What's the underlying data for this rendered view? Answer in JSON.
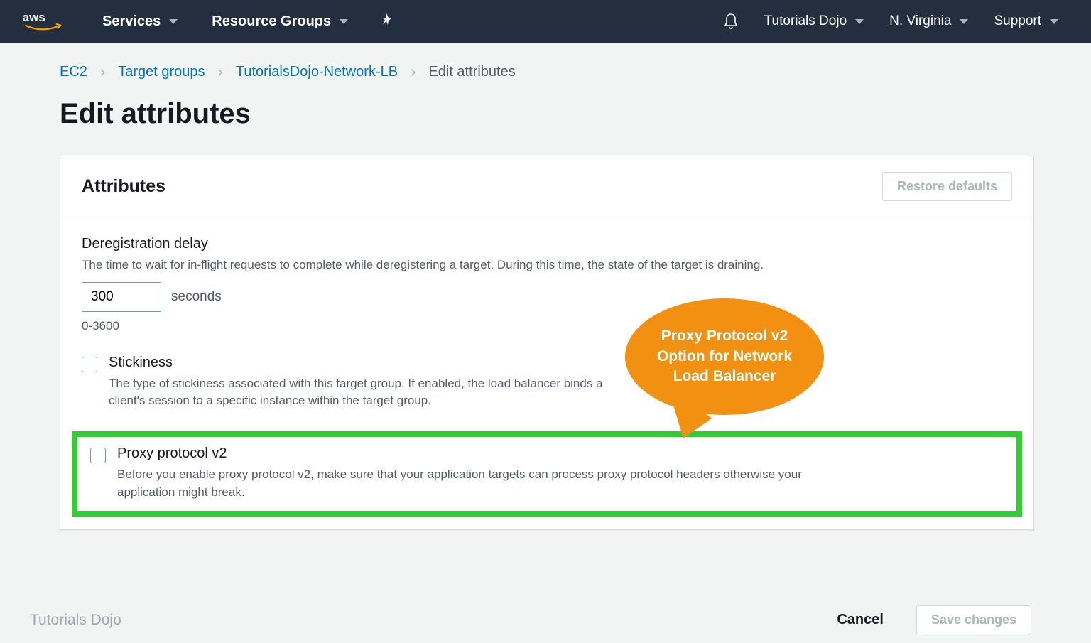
{
  "nav": {
    "services": "Services",
    "resource_groups": "Resource Groups",
    "account": "Tutorials Dojo",
    "region": "N. Virginia",
    "support": "Support"
  },
  "breadcrumb": {
    "items": [
      "EC2",
      "Target groups",
      "TutorialsDojo-Network-LB"
    ],
    "current": "Edit attributes"
  },
  "page": {
    "title": "Edit attributes"
  },
  "panel": {
    "title": "Attributes",
    "restore_btn": "Restore defaults"
  },
  "dereg": {
    "label": "Deregistration delay",
    "desc": "The time to wait for in-flight requests to complete while deregistering a target. During this time, the state of the target is draining.",
    "value": "300",
    "unit": "seconds",
    "range": "0-3600"
  },
  "stickiness": {
    "label": "Stickiness",
    "desc": "The type of stickiness associated with this target group. If enabled, the load balancer binds a client's session to a specific instance within the target group."
  },
  "proxy": {
    "label": "Proxy protocol v2",
    "desc": "Before you enable proxy protocol v2, make sure that your application targets can process proxy protocol headers otherwise your application might break."
  },
  "callout": {
    "text": "Proxy Protocol v2 Option for Network Load Balancer"
  },
  "footer": {
    "watermark": "Tutorials Dojo",
    "cancel": "Cancel",
    "save": "Save changes"
  }
}
